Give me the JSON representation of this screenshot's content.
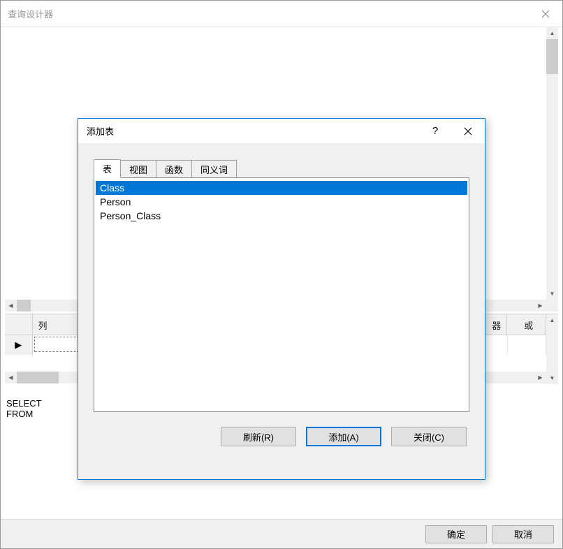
{
  "outer": {
    "title": "查询设计器"
  },
  "grid": {
    "columns": {
      "c1": "列",
      "c3": "器",
      "c4": "或"
    },
    "row_indicator": "▶"
  },
  "sql_pane": "SELECT\nFROM",
  "outer_buttons": {
    "ok": "确定",
    "cancel": "取消"
  },
  "dialog": {
    "title": "添加表",
    "help_glyph": "?",
    "tabs": [
      {
        "label": "表",
        "active": true
      },
      {
        "label": "视图",
        "active": false
      },
      {
        "label": "函数",
        "active": false
      },
      {
        "label": "同义词",
        "active": false
      }
    ],
    "items": [
      {
        "name": "Class",
        "selected": true
      },
      {
        "name": "Person",
        "selected": false
      },
      {
        "name": "Person_Class",
        "selected": false
      }
    ],
    "buttons": {
      "refresh": "刷新(R)",
      "add": "添加(A)",
      "close": "关闭(C)"
    }
  }
}
